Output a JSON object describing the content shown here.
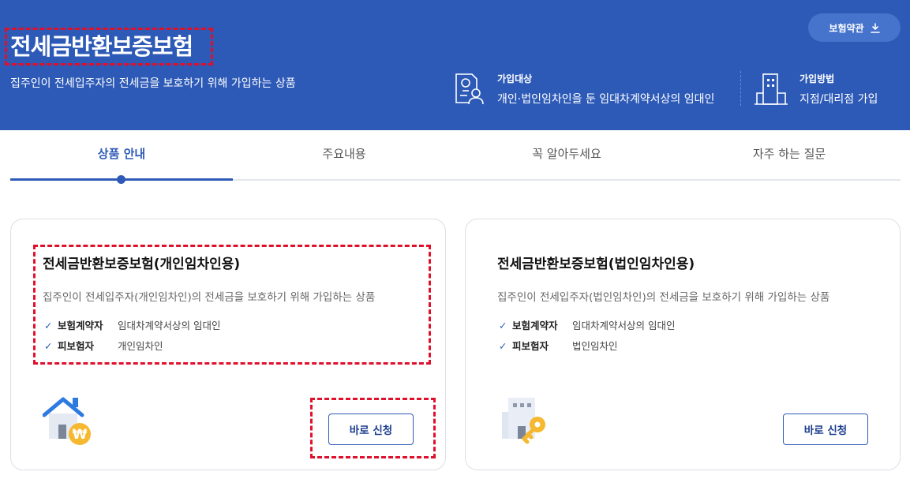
{
  "hero": {
    "title": "전세금반환보증보험",
    "subtitle": "집주인이 전세입주자의 전세금을 보호하기 위해 가입하는 상품",
    "terms_button": "보험약관",
    "target": {
      "label": "가입대상",
      "value": "개인·법인임차인을 둔 임대차계약서상의 임대인"
    },
    "method": {
      "label": "가입방법",
      "value": "지점/대리점 가입"
    }
  },
  "tabs": [
    {
      "label": "상품 안내",
      "active": true
    },
    {
      "label": "주요내용",
      "active": false
    },
    {
      "label": "꼭 알아두세요",
      "active": false
    },
    {
      "label": "자주 하는 질문",
      "active": false
    }
  ],
  "cards": [
    {
      "title": "전세금반환보증보험(개인임차인용)",
      "desc": "집주인이 전세입주자(개인임차인)의 전세금을 보호하기 위해 가입하는 상품",
      "rows": [
        {
          "key": "보험계약자",
          "value": "임대차계약서상의 임대인"
        },
        {
          "key": "피보험자",
          "value": "개인임차인"
        }
      ],
      "button": "바로 신청"
    },
    {
      "title": "전세금반환보증보험(법인임차인용)",
      "desc": "집주인이 전세입주자(법인임차인)의 전세금을 보호하기 위해 가입하는 상품",
      "rows": [
        {
          "key": "보험계약자",
          "value": "임대차계약서상의 임대인"
        },
        {
          "key": "피보험자",
          "value": "법인임차인"
        }
      ],
      "button": "바로 신청"
    }
  ],
  "colors": {
    "primary": "#2d5ab7",
    "highlight": "#e0102b",
    "accent": "#f5b82e"
  },
  "icons": [
    "download-icon",
    "document-person-icon",
    "building-icon",
    "check-icon",
    "house-won-icon",
    "building-key-icon"
  ]
}
